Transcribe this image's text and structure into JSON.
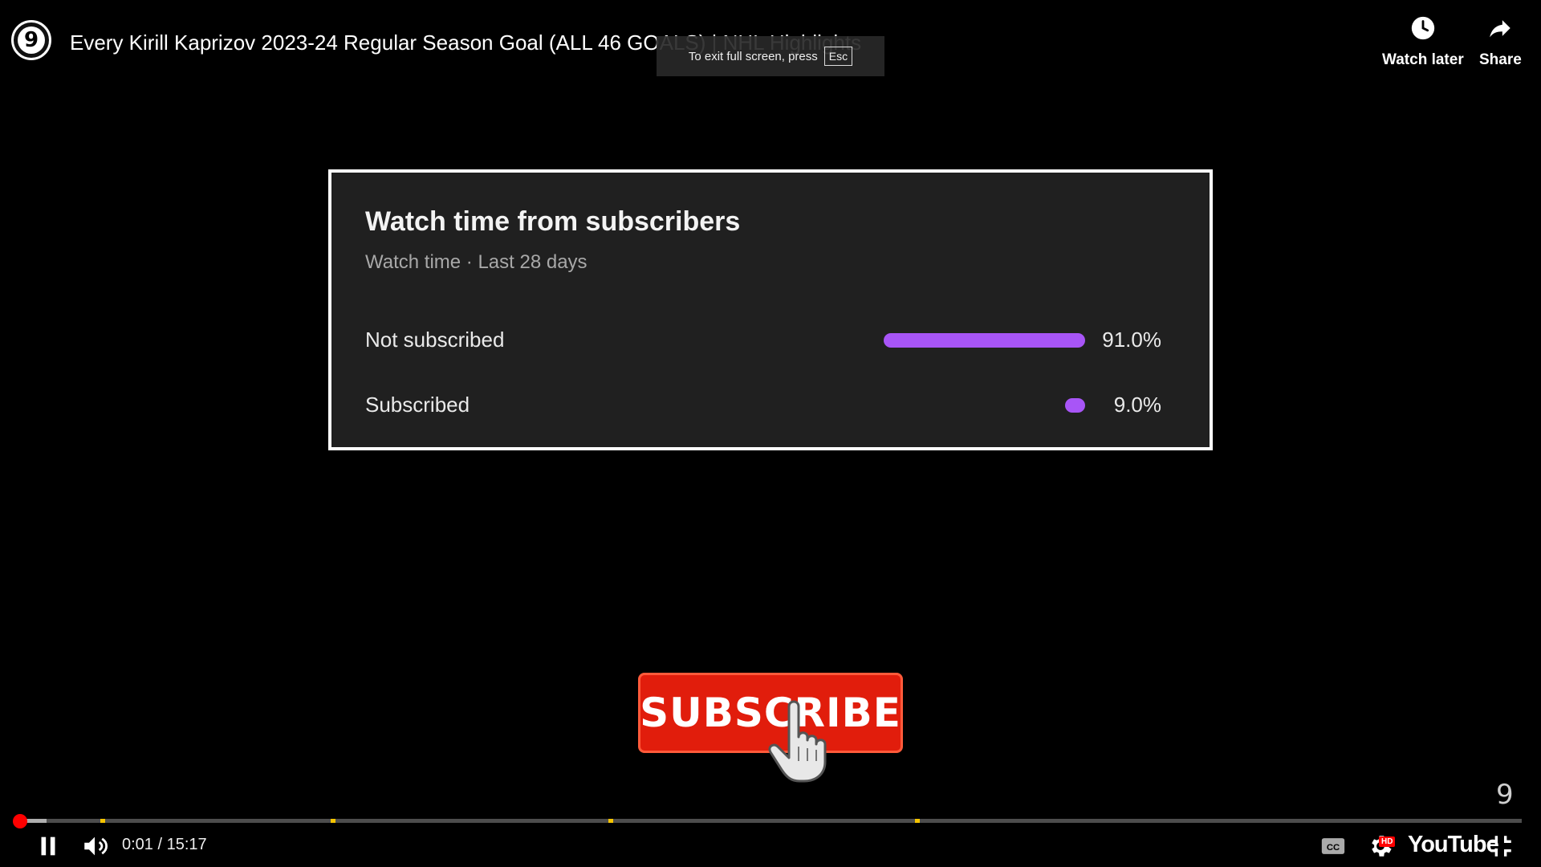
{
  "header": {
    "title": "Every Kirill Kaprizov 2023-24 Regular Season Goal (ALL 46 GOALS) | NHL Highlights",
    "channel_avatar_text": "9",
    "watch_later_label": "Watch later",
    "share_label": "Share"
  },
  "fullscreen_toast": {
    "text": "To exit full screen, press",
    "key": "Esc"
  },
  "video_frame": {
    "card": {
      "title": "Watch time from subscribers",
      "subtitle": "Watch time · Last 28 days",
      "rows": [
        {
          "label": "Not subscribed",
          "value_text": "91.0%",
          "fraction": 0.91
        },
        {
          "label": "Subscribed",
          "value_text": "9.0%",
          "fraction": 0.09
        }
      ],
      "bar_color": "#a855f7"
    },
    "subscribe_text": "SUBSCRIBE",
    "watermark": "9"
  },
  "player": {
    "current_time": "0:01",
    "duration": "15:17",
    "time_text": "0:01 / 15:17",
    "progress_fraction": 0.001,
    "buffer_fraction": 0.018,
    "chapter_marker_fractions": [
      0.054,
      0.207,
      0.392,
      0.596
    ],
    "hd_badge": "HD",
    "logo_text": "YouTube",
    "accent_color": "#ff0000",
    "chapter_color": "#f5c400",
    "icons": [
      "pause-icon",
      "volume-icon",
      "captions-icon",
      "settings-icon",
      "exit-fullscreen-icon",
      "clock-icon",
      "share-arrow-icon"
    ]
  }
}
